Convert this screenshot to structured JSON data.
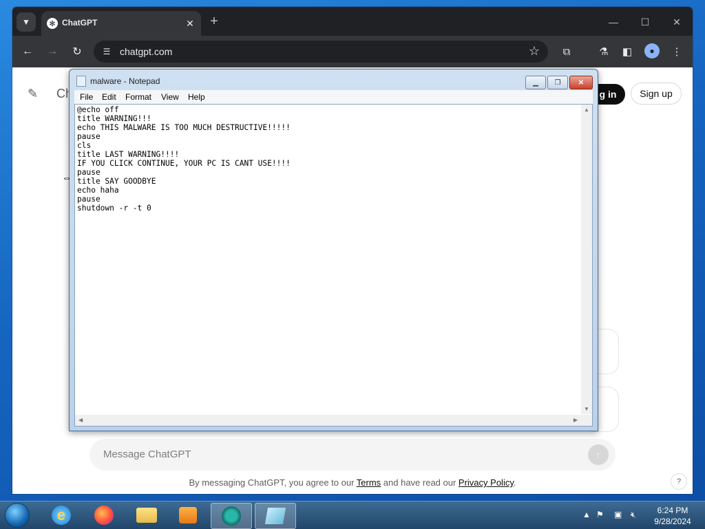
{
  "browser": {
    "tab": {
      "title": "ChatGPT"
    },
    "url": "chatgpt.com"
  },
  "chatgpt": {
    "brand_fragment": "Ch",
    "login_label": "g in",
    "signup_label": "Sign up",
    "composer_placeholder": "Message ChatGPT",
    "disclaimer": {
      "prefix": "By messaging ChatGPT, you agree to our ",
      "terms": "Terms",
      "middle": " and have read our ",
      "privacy": "Privacy Policy",
      "suffix": "."
    },
    "help": "?"
  },
  "notepad": {
    "title": "malware - Notepad",
    "menu": [
      "File",
      "Edit",
      "Format",
      "View",
      "Help"
    ],
    "content": "@echo off\ntitle WARNING!!!\necho THIS MALWARE IS TOO MUCH DESTRUCTIVE!!!!!\npause\ncls\ntitle LAST WARNING!!!!\nIF YOU CLICK CONTINUE, YOUR PC IS CANT USE!!!!\npause\ntitle SAY GOODBYE\necho haha\npause\nshutdown -r -t 0"
  },
  "taskbar": {
    "time": "6:24 PM",
    "date": "9/28/2024"
  }
}
